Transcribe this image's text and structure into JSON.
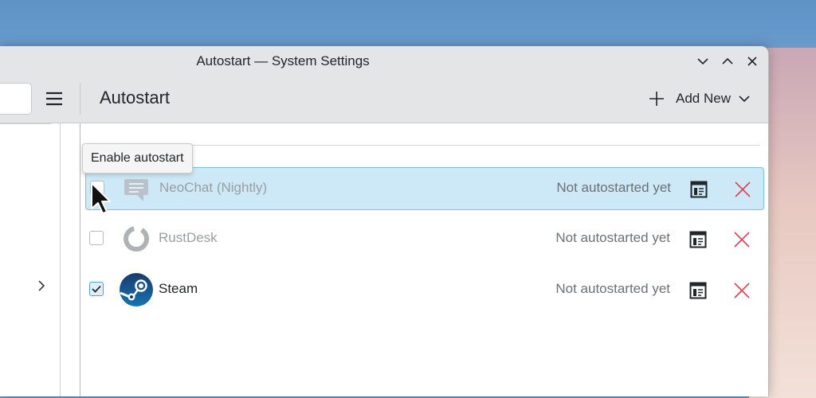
{
  "window": {
    "title": "Autostart — System Settings"
  },
  "toolbar": {
    "page_title": "Autostart",
    "add_new_label": "Add New"
  },
  "tooltip": {
    "text": "Enable autostart"
  },
  "entries": [
    {
      "name": "NeoChat (Nightly)",
      "status": "Not autostarted yet",
      "enabled": false,
      "selected": true,
      "icon": "neochat-icon"
    },
    {
      "name": "RustDesk",
      "status": "Not autostarted yet",
      "enabled": false,
      "selected": false,
      "icon": "rustdesk-icon"
    },
    {
      "name": "Steam",
      "status": "Not autostarted yet",
      "enabled": true,
      "selected": false,
      "icon": "steam-icon"
    }
  ],
  "colors": {
    "accent": "#3daee9",
    "selection_bg": "#cde8f6",
    "delete_red": "#da4453"
  }
}
